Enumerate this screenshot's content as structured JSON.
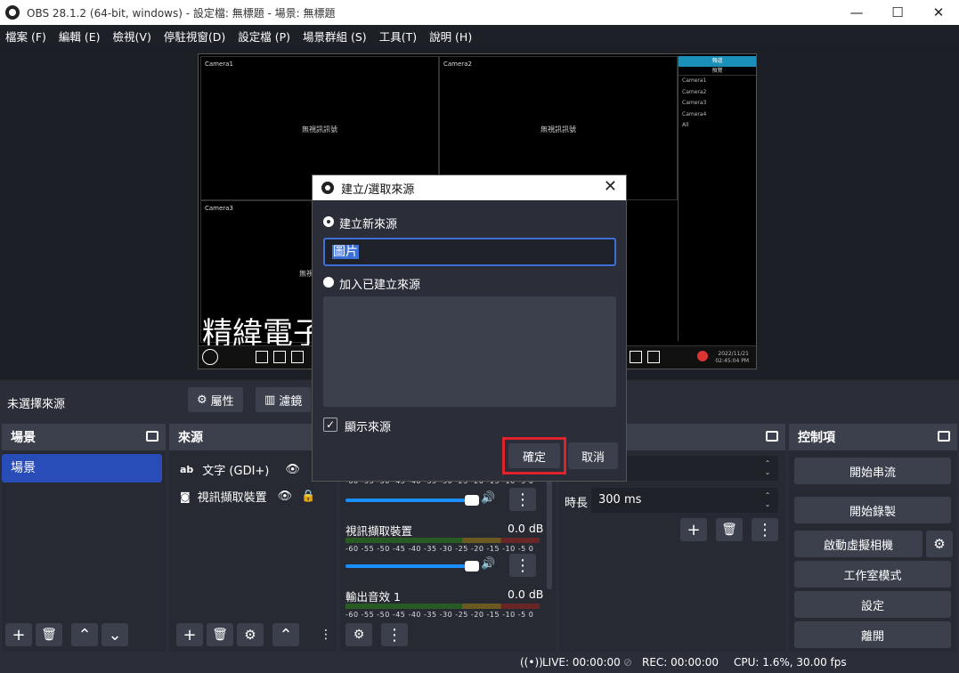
{
  "window": {
    "title": "OBS 28.1.2 (64-bit, windows) - 設定檔: 無標題 - 場景: 無標題",
    "minimize": "—",
    "maximize": "☐",
    "close": "✕"
  },
  "menu": [
    "檔案 (F)",
    "編輯 (E)",
    "檢視(V)",
    "停駐視窗(D)",
    "設定檔 (P)",
    "場景群組 (S)",
    "工具(T)",
    "說明 (H)"
  ],
  "preview": {
    "cameras": [
      "Camera1",
      "Camera2",
      "Camera3"
    ],
    "no_signal": "無視訊訊號",
    "no_signal_partial": "無視",
    "side_header": "頻道",
    "side_sub": "預覽",
    "side_items": [
      "Camera1",
      "Camera2",
      "Camera3",
      "Camera4",
      "All"
    ],
    "overlay_text": "精緯電子",
    "clock_date": "2022/11/21",
    "clock_time": "02:45:04 PM"
  },
  "source_bar": {
    "no_source": "未選擇來源",
    "properties": "屬性",
    "filters": "濾鏡"
  },
  "scenes": {
    "title": "場景",
    "items": [
      "場景"
    ]
  },
  "sources": {
    "title": "來源",
    "items": [
      {
        "icon": "text-icon",
        "label": "文字 (GDI+)"
      },
      {
        "icon": "camera-icon",
        "label": "視訊擷取裝置"
      }
    ]
  },
  "mixer": {
    "scale": "-60 -55 -50 -45 -40 -35 -30 -25 -20 -15 -10 -5 0",
    "channels": [
      {
        "name": "視訊擷取裝置",
        "db": "0.0 dB"
      },
      {
        "name": "輸出音效 1",
        "db": "0.0 dB"
      }
    ]
  },
  "transitions": {
    "duration_label": "時長",
    "duration_value": "300 ms"
  },
  "controls": {
    "title": "控制項",
    "buttons": [
      "開始串流",
      "開始錄製",
      "啟動虛擬相機",
      "工作室模式",
      "設定",
      "離開"
    ]
  },
  "status": {
    "live": "LIVE: 00:00:00",
    "rec": "REC: 00:00:00",
    "cpu": "CPU: 1.6%, 30.00 fps"
  },
  "dialog": {
    "title": "建立/選取來源",
    "create_new": "建立新來源",
    "name_value": "圖片",
    "add_existing": "加入已建立來源",
    "show_source": "顯示來源",
    "show_source_checked": true,
    "ok": "確定",
    "cancel": "取消"
  },
  "colors": {
    "accent": "#284cb8",
    "highlight": "#e0222c",
    "panel": "#3c404d"
  }
}
